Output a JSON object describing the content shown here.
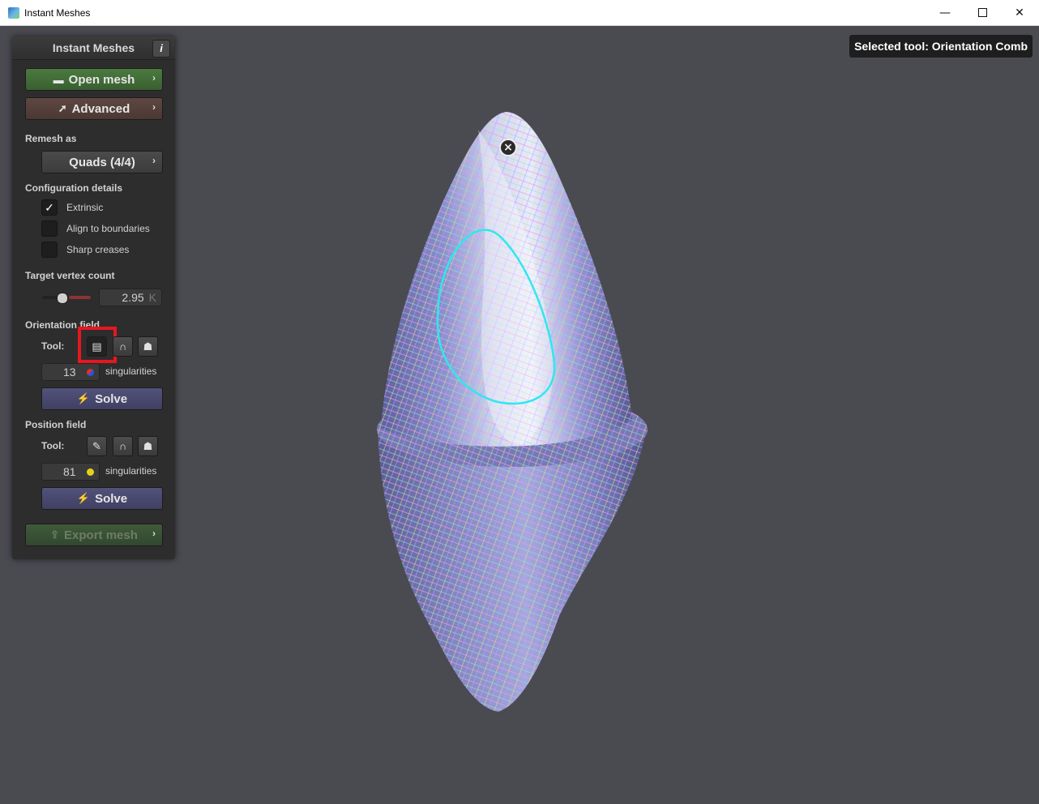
{
  "window": {
    "title": "Instant Meshes",
    "minimize": "—",
    "close": "✕"
  },
  "viewport": {
    "selected_tool_label": "Selected tool: Orientation Comb"
  },
  "panel": {
    "title": "Instant Meshes",
    "info_label": "i",
    "open_mesh_label": "Open mesh",
    "advanced_label": "Advanced",
    "chevron": "›",
    "remesh_as_label": "Remesh as",
    "remesh_as_value": "Quads (4/4)",
    "config_label": "Configuration details",
    "options": [
      {
        "label": "Extrinsic",
        "checked": true,
        "mark": "✓"
      },
      {
        "label": "Align to boundaries",
        "checked": false,
        "mark": ""
      },
      {
        "label": "Sharp creases",
        "checked": false,
        "mark": ""
      }
    ],
    "target_vertex_label": "Target vertex count",
    "target_vertex_value": "2.95",
    "target_vertex_unit": "K",
    "orientation_field_label": "Orientation field",
    "tool_label": "Tool:",
    "orientation_singularities_count": "13",
    "singularities_label": "singularities",
    "solve_label": "Solve",
    "position_field_label": "Position field",
    "position_singularities_count": "81",
    "export_mesh_label": "Export mesh"
  },
  "icons": {
    "folder": "folder-icon",
    "rocket": "rocket-icon",
    "comb": "comb-icon",
    "magnet": "magnet-icon",
    "ghost": "ghost-icon",
    "brush": "brush-icon",
    "bolt": "bolt-icon",
    "export": "export-icon"
  },
  "colors": {
    "background": "#4a4a51",
    "highlight": "#e8161e",
    "green_button": "#4a7a3f",
    "solve_button": "#52527a"
  }
}
